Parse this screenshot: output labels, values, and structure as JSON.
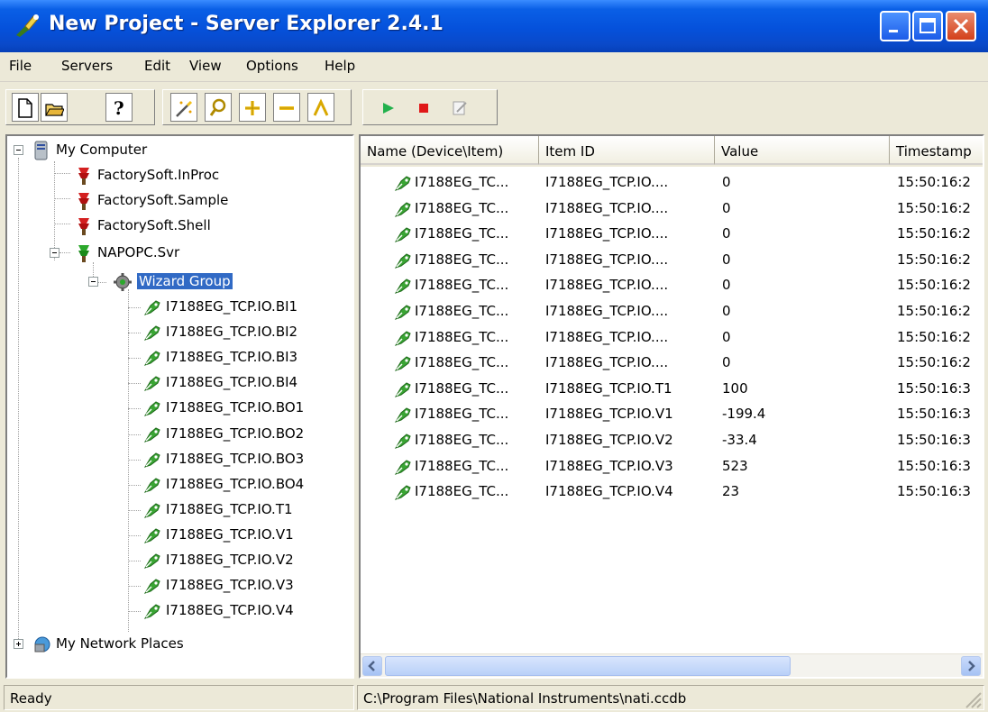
{
  "window": {
    "title": "New Project - Server Explorer 2.4.1"
  },
  "menu": [
    "File",
    "Servers",
    "Edit",
    "View",
    "Options",
    "Help"
  ],
  "toolbar": {
    "groups": [
      [
        "new-file-icon",
        "open-folder-icon",
        "help-icon"
      ],
      [
        "wizard-icon",
        "search-icon",
        "add-icon",
        "remove-icon",
        "tool-icon"
      ],
      [
        "play-icon",
        "stop-icon",
        "edit-icon"
      ]
    ]
  },
  "tree": {
    "root": "My Computer",
    "servers": [
      "FactorySoft.InProc",
      "FactorySoft.Sample",
      "FactorySoft.Shell",
      "NAPOPC.Svr"
    ],
    "group": "Wizard Group",
    "items": [
      "I7188EG_TCP.IO.BI1",
      "I7188EG_TCP.IO.BI2",
      "I7188EG_TCP.IO.BI3",
      "I7188EG_TCP.IO.BI4",
      "I7188EG_TCP.IO.BO1",
      "I7188EG_TCP.IO.BO2",
      "I7188EG_TCP.IO.BO3",
      "I7188EG_TCP.IO.BO4",
      "I7188EG_TCP.IO.T1",
      "I7188EG_TCP.IO.V1",
      "I7188EG_TCP.IO.V2",
      "I7188EG_TCP.IO.V3",
      "I7188EG_TCP.IO.V4"
    ],
    "network": "My Network Places"
  },
  "list": {
    "columns": [
      "Name (Device\\Item)",
      "Item ID",
      "Value",
      "Timestamp"
    ],
    "rows": [
      [
        "I7188EG_TC...",
        "I7188EG_TCP.IO....",
        "0",
        "15:50:16:2"
      ],
      [
        "I7188EG_TC...",
        "I7188EG_TCP.IO....",
        "0",
        "15:50:16:2"
      ],
      [
        "I7188EG_TC...",
        "I7188EG_TCP.IO....",
        "0",
        "15:50:16:2"
      ],
      [
        "I7188EG_TC...",
        "I7188EG_TCP.IO....",
        "0",
        "15:50:16:2"
      ],
      [
        "I7188EG_TC...",
        "I7188EG_TCP.IO....",
        "0",
        "15:50:16:2"
      ],
      [
        "I7188EG_TC...",
        "I7188EG_TCP.IO....",
        "0",
        "15:50:16:2"
      ],
      [
        "I7188EG_TC...",
        "I7188EG_TCP.IO....",
        "0",
        "15:50:16:2"
      ],
      [
        "I7188EG_TC...",
        "I7188EG_TCP.IO....",
        "0",
        "15:50:16:2"
      ],
      [
        "I7188EG_TC...",
        "I7188EG_TCP.IO.T1",
        "100",
        "15:50:16:3"
      ],
      [
        "I7188EG_TC...",
        "I7188EG_TCP.IO.V1",
        "-199.4",
        "15:50:16:3"
      ],
      [
        "I7188EG_TC...",
        "I7188EG_TCP.IO.V2",
        "-33.4",
        "15:50:16:3"
      ],
      [
        "I7188EG_TC...",
        "I7188EG_TCP.IO.V3",
        "523",
        "15:50:16:3"
      ],
      [
        "I7188EG_TC...",
        "I7188EG_TCP.IO.V4",
        "23",
        "15:50:16:3"
      ]
    ]
  },
  "status": {
    "left": "Ready",
    "right": "C:\\Program Files\\National Instruments\\nati.ccdb"
  },
  "colors": {
    "titlebar": "#0551DB",
    "selection": "#316AC5",
    "server_red": "#D42020",
    "server_green": "#2BA82B",
    "tag_green": "#3AA534"
  }
}
